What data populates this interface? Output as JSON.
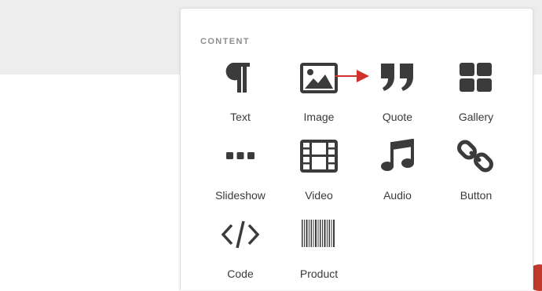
{
  "panel": {
    "section_title": "CONTENT",
    "blocks": [
      {
        "label": "Text",
        "icon": "paragraph-icon"
      },
      {
        "label": "Image",
        "icon": "image-icon"
      },
      {
        "label": "Quote",
        "icon": "quote-icon"
      },
      {
        "label": "Gallery",
        "icon": "gallery-icon"
      },
      {
        "label": "Slideshow",
        "icon": "slideshow-icon"
      },
      {
        "label": "Video",
        "icon": "video-icon"
      },
      {
        "label": "Audio",
        "icon": "music-note-icon"
      },
      {
        "label": "Button",
        "icon": "link-icon"
      },
      {
        "label": "Code",
        "icon": "code-icon"
      },
      {
        "label": "Product",
        "icon": "barcode-icon"
      }
    ]
  },
  "colors": {
    "icon": "#3b3b3b",
    "annotation_arrow": "#d0312d",
    "background_band": "#ededed"
  }
}
